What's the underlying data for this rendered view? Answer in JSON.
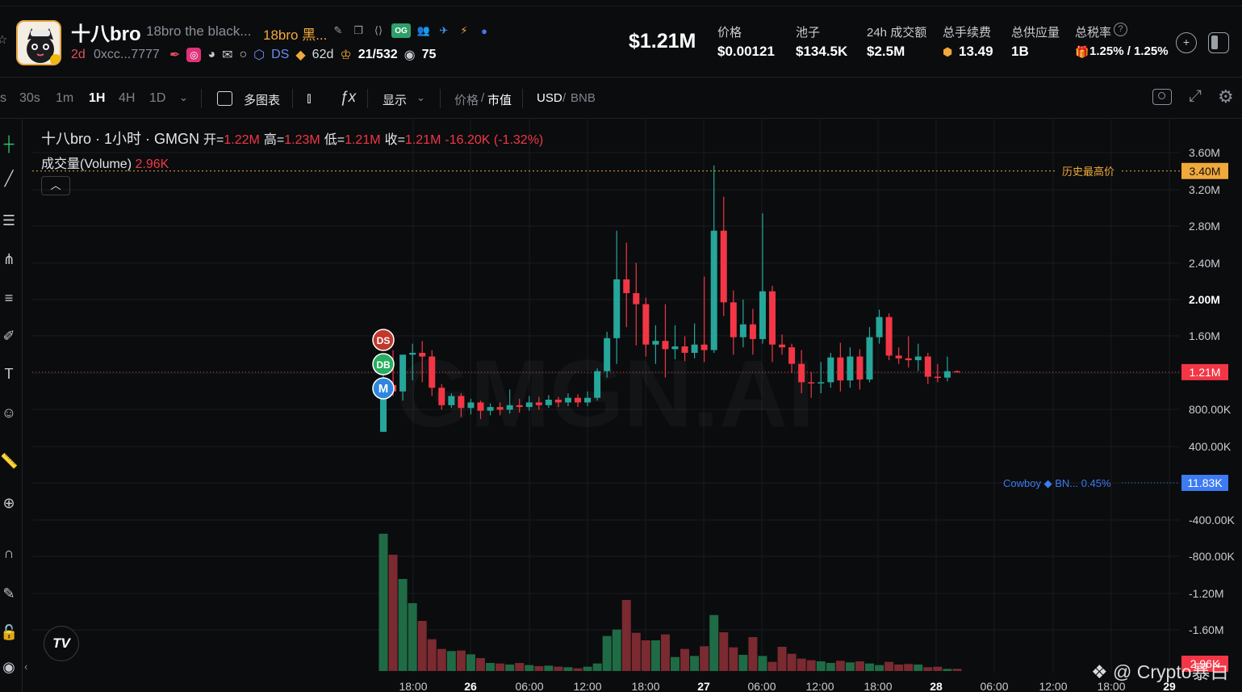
{
  "header": {
    "token_name": "十八bro",
    "token_fullname": "18bro the black...",
    "token_cn_name": "18bro 黑...",
    "og_badge": "OG",
    "age": "2d",
    "address": "0xcc...7777",
    "ds_label": "DS",
    "ds_days": "62d",
    "holders_ratio": "21/532",
    "viewers": "75",
    "market_cap": "$1.21M",
    "stats": [
      {
        "label": "价格",
        "value": "$0.00121"
      },
      {
        "label": "池子",
        "value": "$134.5K"
      },
      {
        "label": "24h 成交额",
        "value": "$2.5M"
      },
      {
        "label": "总手续费",
        "value": "13.49"
      },
      {
        "label": "总供应量",
        "value": "1B"
      },
      {
        "label": "总税率",
        "value": "1.25% / 1.25%"
      }
    ]
  },
  "toolbar": {
    "timeframes": [
      "s",
      "30s",
      "1m",
      "1H",
      "4H",
      "1D"
    ],
    "active_timeframe": "1H",
    "multi_chart": "多图表",
    "display": "显示",
    "price_label": "价格",
    "mcap_label": "市值",
    "currency_usd": "USD",
    "currency_bnb": "BNB"
  },
  "legend": {
    "title": "十八bro · 1小时 · GMGN",
    "open_label": "开=",
    "open": "1.22M",
    "high_label": "高=",
    "high": "1.23M",
    "low_label": "低=",
    "low": "1.21M",
    "close_label": "收=",
    "close": "1.21M",
    "change": "-16.20K (-1.32%)",
    "volume_label": "成交量(Volume)",
    "volume_value": "2.96K"
  },
  "chart_overlay": {
    "ath_label": "历史最高价",
    "ath_tag": "3.40M",
    "current_tag": "1.21M",
    "cowboy_label": "Cowboy ◆ BN... 0.45%",
    "cowboy_tag": "11.83K",
    "volume_tag": "2.96K",
    "marker_ds": "DS",
    "marker_db": "DB",
    "marker_m": "M",
    "watermark_bg": "GMGN.AI",
    "watermark_corner": "@ Crypto暴白",
    "tv_logo": "TV"
  },
  "colors": {
    "up": "#26a69a",
    "up_body": "#1f8a6f",
    "down": "#f23645",
    "ath": "#f0a93b",
    "cowboy": "#3d7bf2"
  },
  "chart_data": {
    "type": "candlestick",
    "y_unit": "market cap (USD)",
    "y_ticks": [
      "3.60M",
      "3.20M",
      "2.80M",
      "2.40M",
      "2.00M",
      "1.60M",
      "800.00K",
      "400.00K",
      "-400.00K",
      "-800.00K",
      "-1.20M",
      "-1.60M"
    ],
    "x_ticks": [
      "18:00",
      "26",
      "06:00",
      "12:00",
      "18:00",
      "27",
      "06:00",
      "12:00",
      "18:00",
      "28",
      "06:00",
      "12:00",
      "18:00",
      "29"
    ],
    "ath": 3.4,
    "candles": [
      [
        0.56,
        1.07,
        0.56,
        1.25
      ],
      [
        1.07,
        1.0,
        0.95,
        1.45
      ],
      [
        1.0,
        1.4,
        0.9,
        1.4
      ],
      [
        1.4,
        1.42,
        1.12,
        1.52
      ],
      [
        1.42,
        1.38,
        1.1,
        1.55
      ],
      [
        1.38,
        1.04,
        0.95,
        1.45
      ],
      [
        1.04,
        0.85,
        0.8,
        1.08
      ],
      [
        0.85,
        0.95,
        0.82,
        0.98
      ],
      [
        0.95,
        0.82,
        0.72,
        0.98
      ],
      [
        0.82,
        0.88,
        0.75,
        0.92
      ],
      [
        0.88,
        0.79,
        0.7,
        0.9
      ],
      [
        0.79,
        0.83,
        0.74,
        0.87
      ],
      [
        0.83,
        0.8,
        0.74,
        0.88
      ],
      [
        0.8,
        0.85,
        0.76,
        1.02
      ],
      [
        0.85,
        0.83,
        0.77,
        0.92
      ],
      [
        0.83,
        0.88,
        0.79,
        0.95
      ],
      [
        0.88,
        0.85,
        0.8,
        0.94
      ],
      [
        0.85,
        0.91,
        0.82,
        0.96
      ],
      [
        0.91,
        0.88,
        0.83,
        0.94
      ],
      [
        0.88,
        0.93,
        0.84,
        0.98
      ],
      [
        0.93,
        0.88,
        0.83,
        0.97
      ],
      [
        0.88,
        0.93,
        0.84,
        1.0
      ],
      [
        0.93,
        1.22,
        0.9,
        1.25
      ],
      [
        1.22,
        1.58,
        1.15,
        1.65
      ],
      [
        1.58,
        2.22,
        1.3,
        2.75
      ],
      [
        2.22,
        2.07,
        1.7,
        2.62
      ],
      [
        2.07,
        1.95,
        1.5,
        2.4
      ],
      [
        1.95,
        1.51,
        1.38,
        2.02
      ],
      [
        1.51,
        1.55,
        1.3,
        1.72
      ],
      [
        1.55,
        1.46,
        1.15,
        1.95
      ],
      [
        1.46,
        1.49,
        1.35,
        1.72
      ],
      [
        1.49,
        1.42,
        1.33,
        1.6
      ],
      [
        1.42,
        1.51,
        1.36,
        1.74
      ],
      [
        1.51,
        1.45,
        1.32,
        2.25
      ],
      [
        1.45,
        2.75,
        1.42,
        3.46
      ],
      [
        2.75,
        1.97,
        1.82,
        3.12
      ],
      [
        1.97,
        1.59,
        1.4,
        2.1
      ],
      [
        1.59,
        1.73,
        1.48,
        2.0
      ],
      [
        1.73,
        1.57,
        1.4,
        1.9
      ],
      [
        1.57,
        2.09,
        1.52,
        2.94
      ],
      [
        2.09,
        1.51,
        1.32,
        2.15
      ],
      [
        1.51,
        1.48,
        1.4,
        1.62
      ],
      [
        1.48,
        1.3,
        1.2,
        1.52
      ],
      [
        1.3,
        1.1,
        0.98,
        1.45
      ],
      [
        1.1,
        1.09,
        0.93,
        1.21
      ],
      [
        1.09,
        1.1,
        0.98,
        1.32
      ],
      [
        1.1,
        1.37,
        1.04,
        1.42
      ],
      [
        1.37,
        1.12,
        1.0,
        1.53
      ],
      [
        1.12,
        1.38,
        1.04,
        1.48
      ],
      [
        1.38,
        1.13,
        1.02,
        1.46
      ],
      [
        1.13,
        1.59,
        1.1,
        1.7
      ],
      [
        1.59,
        1.81,
        1.52,
        1.89
      ],
      [
        1.81,
        1.39,
        1.34,
        1.85
      ],
      [
        1.39,
        1.36,
        1.3,
        1.48
      ],
      [
        1.36,
        1.34,
        1.26,
        1.6
      ],
      [
        1.34,
        1.38,
        1.22,
        1.52
      ],
      [
        1.38,
        1.16,
        1.08,
        1.42
      ],
      [
        1.16,
        1.15,
        1.1,
        1.3
      ],
      [
        1.15,
        1.22,
        1.11,
        1.38
      ],
      [
        1.22,
        1.21,
        1.21,
        1.23
      ]
    ],
    "volumes": [
      2.55,
      2.16,
      1.71,
      1.26,
      0.93,
      0.59,
      0.41,
      0.37,
      0.38,
      0.31,
      0.24,
      0.15,
      0.14,
      0.12,
      0.15,
      0.11,
      0.09,
      0.1,
      0.08,
      0.07,
      0.05,
      0.08,
      0.14,
      0.65,
      0.77,
      1.32,
      0.71,
      0.57,
      0.57,
      0.68,
      0.26,
      0.41,
      0.28,
      0.46,
      1.04,
      0.72,
      0.44,
      0.3,
      0.63,
      0.28,
      0.17,
      0.45,
      0.32,
      0.23,
      0.2,
      0.18,
      0.15,
      0.19,
      0.16,
      0.18,
      0.14,
      0.11,
      0.17,
      0.12,
      0.13,
      0.12,
      0.07,
      0.08,
      0.04,
      0.04
    ],
    "grid": true
  }
}
